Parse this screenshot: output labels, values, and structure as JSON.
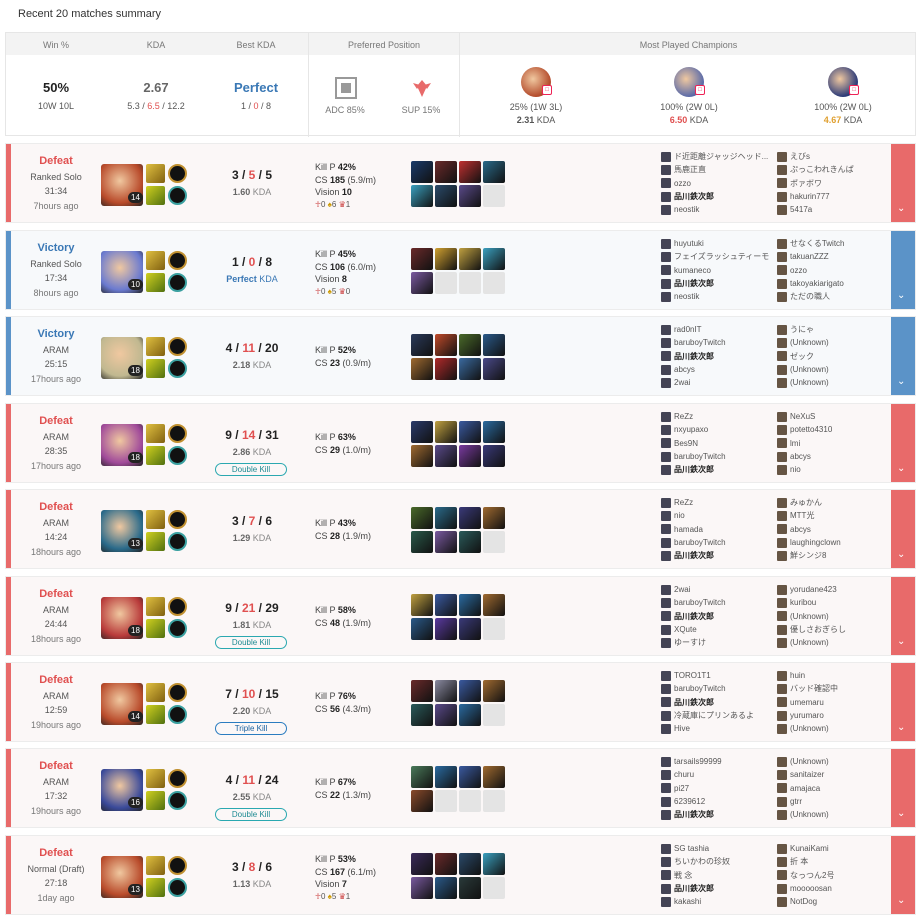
{
  "summary": {
    "title": "Recent 20 matches summary",
    "headers": {
      "winrate": "Win %",
      "kda": "KDA",
      "best_kda": "Best KDA",
      "position": "Preferred Position",
      "champions": "Most Played Champions"
    },
    "winrate": {
      "value": "50%",
      "record": "10W 10L"
    },
    "kda": {
      "value": "2.67",
      "k": "5.3",
      "sep1": " / ",
      "d": "6.5",
      "sep2": " / ",
      "a": "12.2"
    },
    "best_kda": {
      "value": "Perfect",
      "k": "1",
      "sep1": " / ",
      "d": "0",
      "sep2": " / ",
      "a": "8"
    },
    "positions": [
      {
        "label": "ADC",
        "pct": "85%",
        "icon": "adc-icon"
      },
      {
        "label": "SUP",
        "pct": "15%",
        "icon": "support-icon"
      }
    ],
    "champions": [
      {
        "record": "25% (1W 3L)",
        "kda": "2.31",
        "kda_label": " KDA",
        "kda_color": "#555555",
        "color": "#b34a2a"
      },
      {
        "record": "100% (2W 0L)",
        "kda": "6.50",
        "kda_label": " KDA",
        "kda_color": "#e05050",
        "color": "#5a6aa8"
      },
      {
        "record": "100% (2W 0L)",
        "kda": "4.67",
        "kda_label": " KDA",
        "kda_color": "#e0a030",
        "color": "#2b3a78"
      }
    ]
  },
  "colors": {
    "win": "#5b93c8",
    "loss": "#e86a6a",
    "win_text": "#3a78b5",
    "loss_text": "#e05050"
  },
  "matches": [
    {
      "result": "Defeat",
      "win": false,
      "queue": "Ranked Solo",
      "duration": "31:34",
      "ago": "7hours ago",
      "level": "14",
      "k": "3",
      "d": "5",
      "a": "5",
      "ratio": "1.60",
      "ratio_label": " KDA",
      "multikill": "",
      "stats": {
        "killp_label": "Kill P ",
        "killp": "42%",
        "cs_label": "CS ",
        "cs": "185",
        "cspm": " (5.9/m)",
        "vision_label": "Vision ",
        "vision": "10",
        "obj": [
          "0",
          "6",
          "1"
        ]
      },
      "items": [
        "#1a3a6a",
        "#6a2a2a",
        "#c03030",
        "#2a6a8a",
        "#3aa0c0",
        "#2a4a6a",
        "#5a4a8a",
        ""
      ],
      "team1": [
        "ド近距離ジャッジヘッド...",
        "馬鹿正直",
        "ozzo",
        "品川鉄次郎",
        "neostik"
      ],
      "team2": [
        "えびs",
        "ぷっこわれきんぱ",
        "ポァボワ",
        "hakurin777",
        "5417a"
      ],
      "me": 3
    },
    {
      "result": "Victory",
      "win": true,
      "queue": "Ranked Solo",
      "duration": "17:34",
      "ago": "8hours ago",
      "level": "10",
      "k": "1",
      "d": "0",
      "a": "8",
      "ratio": "Perfect",
      "ratio_label": " KDA",
      "multikill": "",
      "stats": {
        "killp_label": "Kill P ",
        "killp": "45%",
        "cs_label": "CS ",
        "cs": "106",
        "cspm": " (6.0/m)",
        "vision_label": "Vision ",
        "vision": "8",
        "obj": [
          "0",
          "5",
          "0"
        ]
      },
      "items": [
        "#6a2a2a",
        "#d0a030",
        "#c0a040",
        "#3aa0c0",
        "#7a5aa0",
        "",
        "",
        ""
      ],
      "team1": [
        "huyutuki",
        "フェイズラッシュティーモ",
        "kumaneco",
        "品川鉄次郎",
        "neostik"
      ],
      "team2": [
        "せなくるTwitch",
        "takuanZZZ",
        "ozzo",
        "takoyakiarigato",
        "ただの職人"
      ],
      "me": 3
    },
    {
      "result": "Victory",
      "win": true,
      "queue": "ARAM",
      "duration": "25:15",
      "ago": "17hours ago",
      "level": "18",
      "k": "4",
      "d": "11",
      "a": "20",
      "ratio": "2.18",
      "ratio_label": " KDA",
      "multikill": "",
      "stats": {
        "killp_label": "Kill P ",
        "killp": "52%",
        "cs_label": "CS ",
        "cs": "23",
        "cspm": " (0.9/m)",
        "vision_label": "",
        "vision": "",
        "obj": []
      },
      "items": [
        "#2a3a5a",
        "#c04a2a",
        "#4a6a2a",
        "#2a5a8a",
        "#a06a30",
        "#b02a2a",
        "#3a6aa0",
        "#4a4a8a"
      ],
      "team1": [
        "rad0nIT",
        "baruboyTwitch",
        "品川鉄次郎",
        "abcys",
        "2wai"
      ],
      "team2": [
        "うにゃ",
        "(Unknown)",
        "ゼック",
        "(Unknown)",
        "(Unknown)"
      ],
      "me": 2
    },
    {
      "result": "Defeat",
      "win": false,
      "queue": "ARAM",
      "duration": "28:35",
      "ago": "17hours ago",
      "level": "18",
      "k": "9",
      "d": "14",
      "a": "31",
      "ratio": "2.86",
      "ratio_label": " KDA",
      "multikill": "Double Kill",
      "stats": {
        "killp_label": "Kill P ",
        "killp": "63%",
        "cs_label": "CS ",
        "cs": "29",
        "cspm": " (1.0/m)",
        "vision_label": "",
        "vision": "",
        "obj": []
      },
      "items": [
        "#2a3a6a",
        "#c0a040",
        "#3a5aa0",
        "#2a6aa0",
        "#a06a30",
        "#5a4a8a",
        "#7a3aa0",
        "#3a3a7a"
      ],
      "team1": [
        "ReZz",
        "nxyupaxo",
        "Bes9N",
        "baruboyTwitch",
        "品川鉄次郎"
      ],
      "team2": [
        "NeXuS",
        "potetto4310",
        "lmi",
        "abcys",
        "nio"
      ],
      "me": 4
    },
    {
      "result": "Defeat",
      "win": false,
      "queue": "ARAM",
      "duration": "14:24",
      "ago": "18hours ago",
      "level": "13",
      "k": "3",
      "d": "7",
      "a": "6",
      "ratio": "1.29",
      "ratio_label": " KDA",
      "multikill": "",
      "stats": {
        "killp_label": "Kill P ",
        "killp": "43%",
        "cs_label": "CS ",
        "cs": "28",
        "cspm": " (1.9/m)",
        "vision_label": "",
        "vision": "",
        "obj": []
      },
      "items": [
        "#4a6a2a",
        "#2a6a8a",
        "#3a3a7a",
        "#a06a30",
        "#2a5a4a",
        "#7a5aa0",
        "#2a5a5a",
        ""
      ],
      "team1": [
        "ReZz",
        "nio",
        "hamada",
        "baruboyTwitch",
        "品川鉄次郎"
      ],
      "team2": [
        "みゅかん",
        "MTT光",
        "abcys",
        "laughingclown",
        "鮮シンジ8"
      ],
      "me": 4
    },
    {
      "result": "Defeat",
      "win": false,
      "queue": "ARAM",
      "duration": "24:44",
      "ago": "18hours ago",
      "level": "18",
      "k": "9",
      "d": "21",
      "a": "29",
      "ratio": "1.81",
      "ratio_label": " KDA",
      "multikill": "Double Kill",
      "stats": {
        "killp_label": "Kill P ",
        "killp": "58%",
        "cs_label": "CS ",
        "cs": "48",
        "cspm": " (1.9/m)",
        "vision_label": "",
        "vision": "",
        "obj": []
      },
      "items": [
        "#c0a040",
        "#3a5aa0",
        "#2a6aa0",
        "#a06a30",
        "#2a5a8a",
        "#5a3aa0",
        "#3a3a7a",
        ""
      ],
      "team1": [
        "2wai",
        "baruboyTwitch",
        "品川鉄次郎",
        "XQute",
        "ゆーすけ"
      ],
      "team2": [
        "yorudane423",
        "kuribou",
        "(Unknown)",
        "優しさおぎらし",
        "(Unknown)"
      ],
      "me": 2
    },
    {
      "result": "Defeat",
      "win": false,
      "queue": "ARAM",
      "duration": "12:59",
      "ago": "19hours ago",
      "level": "14",
      "k": "7",
      "d": "10",
      "a": "15",
      "ratio": "2.20",
      "ratio_label": " KDA",
      "multikill": "Triple Kill",
      "stats": {
        "killp_label": "Kill P ",
        "killp": "76%",
        "cs_label": "CS ",
        "cs": "56",
        "cspm": " (4.3/m)",
        "vision_label": "",
        "vision": "",
        "obj": []
      },
      "items": [
        "#6a2a2a",
        "#8a8aa0",
        "#3a5aa0",
        "#a06a30",
        "#2a5a5a",
        "#5a4a8a",
        "#2a6aa0",
        ""
      ],
      "team1": [
        "TORO1T1",
        "baruboyTwitch",
        "品川鉄次郎",
        "冷蔵庫にプリンあるよ",
        "Hive"
      ],
      "team2": [
        "huin",
        "バッド確認中",
        "umemaru",
        "yurumaro",
        "(Unknown)"
      ],
      "me": 2
    },
    {
      "result": "Defeat",
      "win": false,
      "queue": "ARAM",
      "duration": "17:32",
      "ago": "19hours ago",
      "level": "16",
      "k": "4",
      "d": "11",
      "a": "24",
      "ratio": "2.55",
      "ratio_label": " KDA",
      "multikill": "Double Kill",
      "stats": {
        "killp_label": "Kill P ",
        "killp": "67%",
        "cs_label": "CS ",
        "cs": "22",
        "cspm": " (1.3/m)",
        "vision_label": "",
        "vision": "",
        "obj": []
      },
      "items": [
        "#4a7a5a",
        "#2a6aa0",
        "#3a5aa0",
        "#a06a30",
        "#8a4a2a",
        "",
        "",
        ""
      ],
      "team1": [
        "tarsails99999",
        "churu",
        "pi27",
        "6239612",
        "品川鉄次郎"
      ],
      "team2": [
        "(Unknown)",
        "sanitaizer",
        "amajaca",
        "gtrr",
        "(Unknown)"
      ],
      "me": 4
    },
    {
      "result": "Defeat",
      "win": false,
      "queue": "Normal (Draft)",
      "duration": "27:18",
      "ago": "1day ago",
      "level": "13",
      "k": "3",
      "d": "8",
      "a": "6",
      "ratio": "1.13",
      "ratio_label": " KDA",
      "multikill": "",
      "stats": {
        "killp_label": "Kill P ",
        "killp": "53%",
        "cs_label": "CS ",
        "cs": "167",
        "cspm": " (6.1/m)",
        "vision_label": "Vision ",
        "vision": "7",
        "obj": [
          "0",
          "5",
          "1"
        ]
      },
      "items": [
        "#3a2a5a",
        "#6a2a2a",
        "#2a4a6a",
        "#3aa0c0",
        "#7a5aa0",
        "#2a5a8a",
        "#2a3a3a",
        ""
      ],
      "team1": [
        "SG tashia",
        "ちいかわの珍奴",
        "戦 念",
        "品川鉄次郎",
        "kakashi"
      ],
      "team2": [
        "KunaiKami",
        "折 本",
        "なっつん2号",
        "mooooosan",
        "NotDog"
      ],
      "me": 3
    }
  ]
}
